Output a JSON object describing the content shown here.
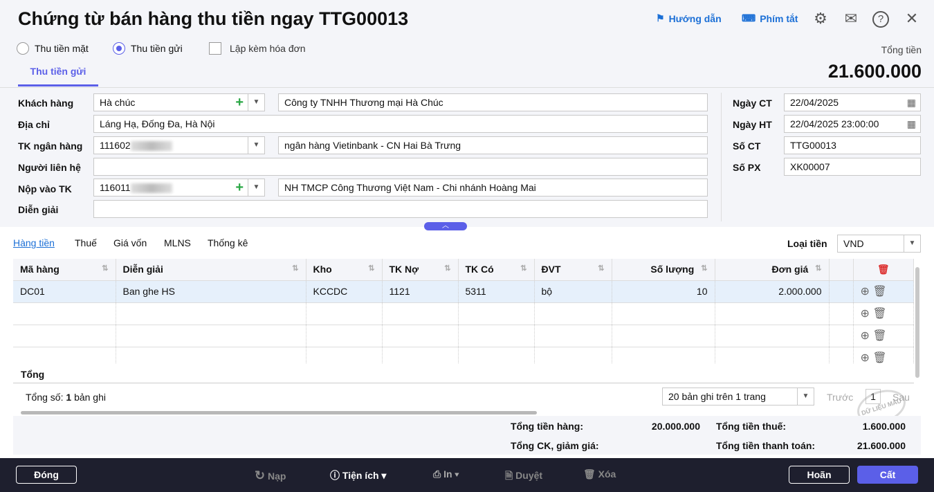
{
  "header": {
    "title": "Chứng từ bán hàng thu tiền ngay TTG00013",
    "guide": "Hướng dẫn",
    "shortcuts": "Phím tắt",
    "total_label": "Tổng tiền",
    "total_value": "21.600.000"
  },
  "options": {
    "cash": "Thu tiền mặt",
    "deposit": "Thu tiền gửi",
    "invoice": "Lập kèm hóa đơn"
  },
  "tab": "Thu tiền gửi",
  "form": {
    "customer_label": "Khách hàng",
    "customer_code": "Hà chúc",
    "customer_name": "Công ty TNHH Thương mại Hà Chúc",
    "address_label": "Địa chỉ",
    "address": "Láng Hạ, Đống Đa, Hà Nội",
    "bank_label": "TK ngân hàng",
    "bank_acc": "111602",
    "bank_name": "ngân hàng Vietinbank - CN Hai Bà Trưng",
    "contact_label": "Người liên hệ",
    "contact": "",
    "deposit_label": "Nộp vào TK",
    "deposit_acc": "116011",
    "deposit_name": "NH TMCP Công Thương Việt Nam - Chi nhánh Hoàng Mai",
    "desc_label": "Diễn giải",
    "desc": "",
    "date_ct_label": "Ngày CT",
    "date_ct": "22/04/2025",
    "date_ht_label": "Ngày HT",
    "date_ht": "22/04/2025 23:00:00",
    "so_ct_label": "Số CT",
    "so_ct": "TTG00013",
    "so_px_label": "Số PX",
    "so_px": "XK00007"
  },
  "subtabs": [
    "Hàng tiền",
    "Thuế",
    "Giá vốn",
    "MLNS",
    "Thống kê"
  ],
  "currency_label": "Loại tiền",
  "currency": "VND",
  "table": {
    "headers": [
      "Mã hàng",
      "Diễn giải",
      "Kho",
      "TK Nợ",
      "TK Có",
      "ĐVT",
      "Số lượng",
      "Đơn giá"
    ],
    "rows": [
      [
        "DC01",
        "Ban ghe HS",
        "KCCDC",
        "1121",
        "5311",
        "bộ",
        "10",
        "2.000.000"
      ]
    ],
    "total_label": "Tổng"
  },
  "pager": {
    "count_prefix": "Tổng số:",
    "count": "1",
    "count_suffix": "bản ghi",
    "page_size": "20 bản ghi trên 1 trang",
    "prev": "Trước",
    "page": "1",
    "next": "Sau"
  },
  "watermark": "DỮ LIỆU MẪU",
  "summary": {
    "goods_label": "Tổng tiền hàng:",
    "goods": "20.000.000",
    "tax_label": "Tổng tiền thuế:",
    "tax": "1.600.000",
    "discount_label": "Tổng CK, giảm giá:",
    "discount": "",
    "pay_label": "Tổng tiền thanh toán:",
    "pay": "21.600.000"
  },
  "footer": {
    "close": "Đóng",
    "reload": "Nạp",
    "utils": "Tiện ích",
    "print": "In",
    "approve": "Duyệt",
    "delete": "Xóa",
    "cancel": "Hoãn",
    "save": "Cất"
  }
}
